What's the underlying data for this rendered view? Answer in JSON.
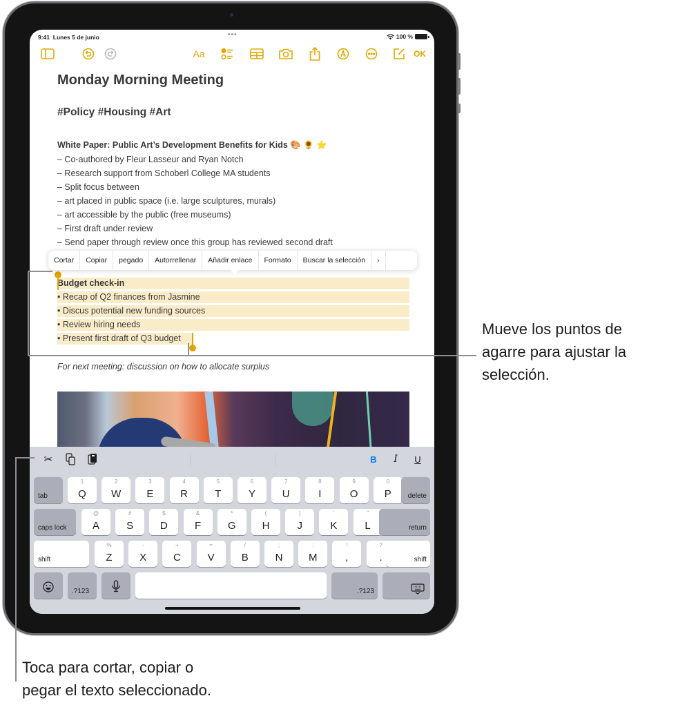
{
  "status_bar": {
    "time": "9:41",
    "date": "Lunes 5 de junio",
    "battery": "100 %"
  },
  "toolbar": {
    "icons": [
      "sidebar-icon",
      "undo-icon",
      "redo-icon",
      "format-icon",
      "checklist-icon",
      "table-icon",
      "camera-icon",
      "share-icon",
      "markup-icon",
      "more-icon",
      "compose-icon"
    ],
    "format_label": "Aa",
    "ok_label": "OK",
    "accent_color": "#e1a800"
  },
  "note": {
    "title": "Monday Morning Meeting",
    "tags": "#Policy #Housing #Art",
    "subtitle": "White Paper: Public Art’s Development Benefits for Kids 🎨 🌻 ⭐",
    "lines": [
      "– Co-authored by Fleur Lasseur and Ryan Notch",
      "– Research support from Schoberl College MA students",
      "– Split focus between",
      "– art placed in public space (i.e. large sculptures, murals)",
      "– art accessible by the public (free museums)",
      "– First draft under review",
      "– Send paper through review once this group has reviewed second draft"
    ],
    "selected": {
      "heading": "Budget check-in",
      "items": [
        "• Recap of Q2 finances from Jasmine",
        "• Discus potential new funding sources",
        "• Review hiring needs",
        "• Present first draft of Q3 budget"
      ]
    },
    "footer_line": "For next meeting: discussion on how to allocate surplus"
  },
  "edit_menu": {
    "items": [
      "Cortar",
      "Copiar",
      "pegado",
      "Autorrellenar",
      "Añadir enlace",
      "Formato",
      "Buscar la selección",
      "›"
    ]
  },
  "shortcut_bar": {
    "left": [
      "scissors-icon",
      "copy-icon",
      "paste-icon"
    ],
    "bold": "B",
    "italic": "I",
    "underline": "U"
  },
  "keyboard": {
    "row1": {
      "tab": "tab",
      "keys": [
        [
          "1",
          "Q"
        ],
        [
          "2",
          "W"
        ],
        [
          "3",
          "E"
        ],
        [
          "4",
          "R"
        ],
        [
          "5",
          "T"
        ],
        [
          "6",
          "Y"
        ],
        [
          "7",
          "U"
        ],
        [
          "8",
          "I"
        ],
        [
          "9",
          "O"
        ],
        [
          "0",
          "P"
        ]
      ],
      "delete": "delete"
    },
    "row2": {
      "caps": "caps lock",
      "keys": [
        [
          "@",
          "A"
        ],
        [
          "#",
          "S"
        ],
        [
          "$",
          "D"
        ],
        [
          "&",
          "F"
        ],
        [
          "*",
          "G"
        ],
        [
          "(",
          "H"
        ],
        [
          ")",
          "J"
        ],
        [
          "’",
          "K"
        ],
        [
          "\"",
          "L"
        ]
      ],
      "return": "return"
    },
    "row3": {
      "shift_left": "shift",
      "keys": [
        [
          "%",
          "Z"
        ],
        [
          "-",
          "X"
        ],
        [
          "+",
          "C"
        ],
        [
          "=",
          "V"
        ],
        [
          "/",
          "B"
        ],
        [
          ";",
          "N"
        ],
        [
          ":",
          "M"
        ],
        [
          "!",
          ","
        ],
        [
          "?",
          "."
        ]
      ],
      "shift_right": "shift"
    },
    "row4": {
      "numbers_left": ".?123",
      "numbers_right": ".?123"
    }
  },
  "callouts": {
    "right": [
      "Mueve los puntos de",
      "agarre para ajustar la",
      "selección."
    ],
    "bottom": [
      "Toca para cortar, copiar o",
      "pegar el texto seleccionado."
    ]
  }
}
